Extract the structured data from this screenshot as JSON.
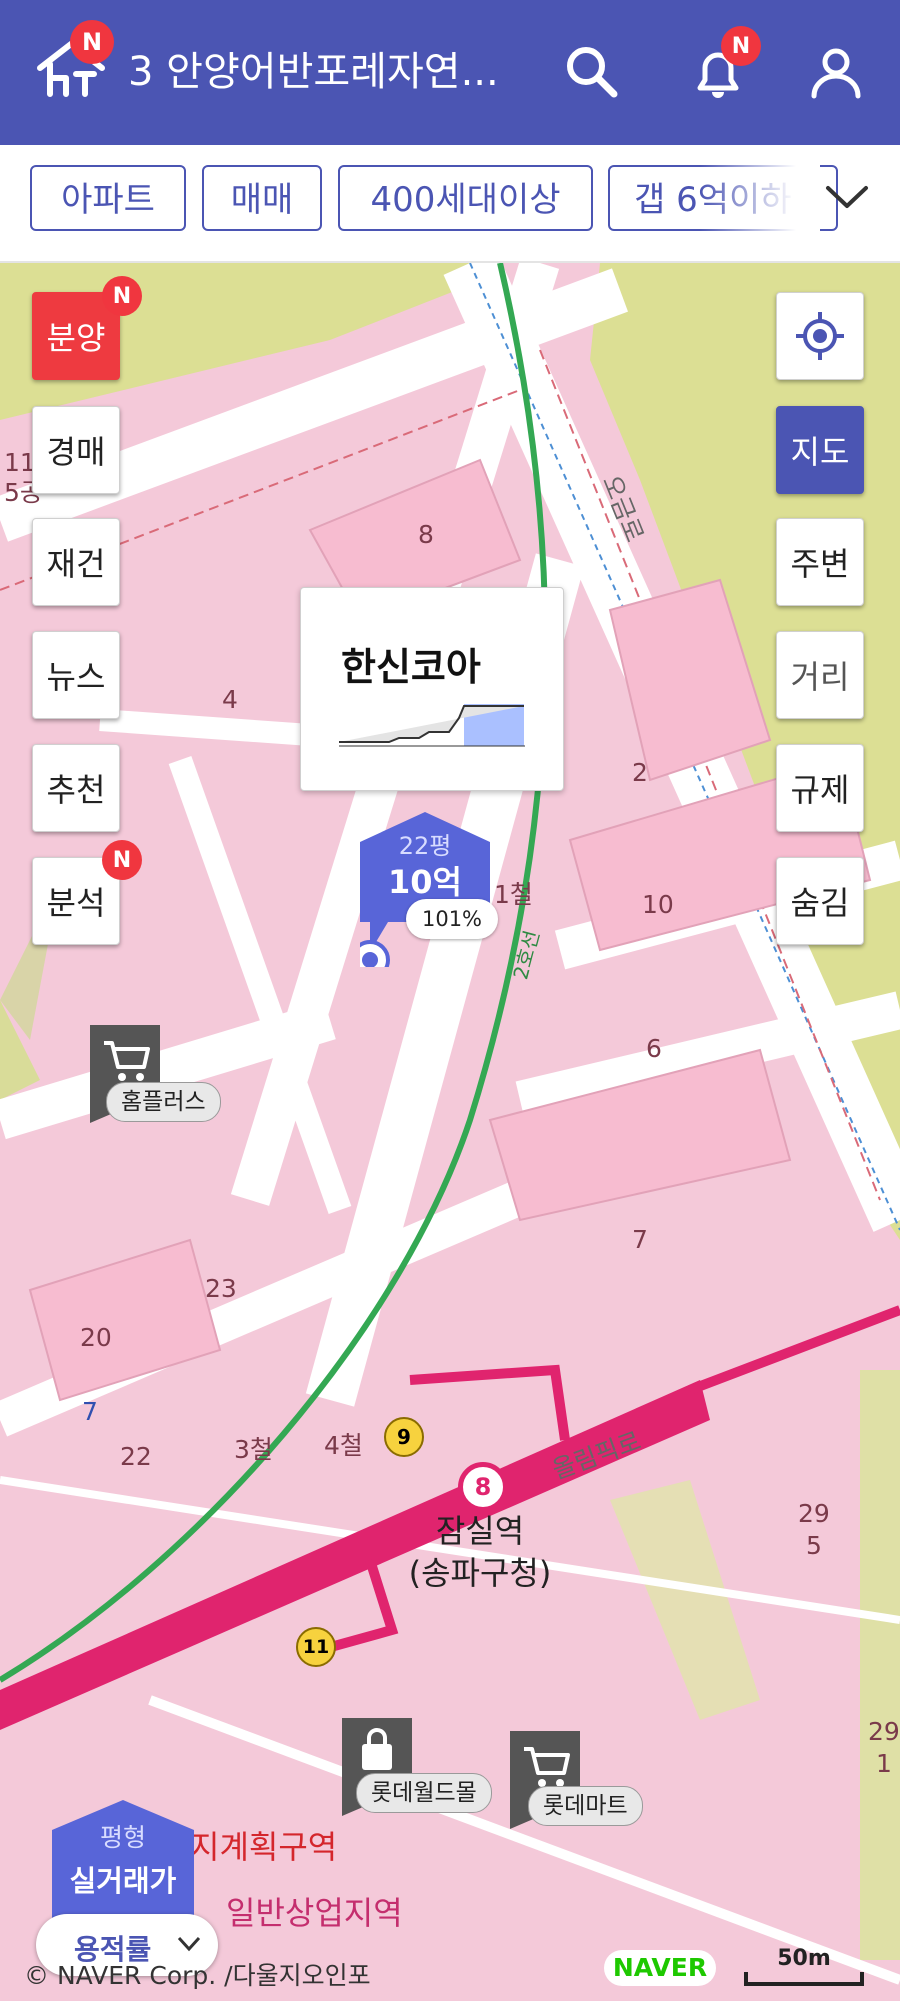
{
  "header": {
    "logo_badge": "N",
    "title": "3  안양어반포레자연...",
    "bell_badge": "N"
  },
  "filters": {
    "chips": [
      "아파트",
      "매매",
      "400세대이상",
      "갭 6억이하"
    ]
  },
  "left_buttons": [
    "분양",
    "경매",
    "재건",
    "뉴스",
    "추천",
    "분석"
  ],
  "left_badges": {
    "presale": "N",
    "analysis": "N"
  },
  "right_buttons": [
    "지도",
    "주변",
    "거리",
    "규제",
    "숨김"
  ],
  "popup": {
    "name": "한신코아"
  },
  "marker": {
    "size": "22평",
    "price": "10억",
    "percent": "101%"
  },
  "map_labels": {
    "blocks": [
      "8",
      "4",
      "2",
      "10",
      "6",
      "7",
      "23",
      "20",
      "22",
      "7",
      "29\n5",
      "29\n1",
      "11\n5공"
    ],
    "rail_exits": [
      "1철",
      "3철",
      "4철"
    ],
    "road_1": "오금로",
    "road_2": "올림픽로",
    "line2": "2호선",
    "line8": "8",
    "exit_9": "9",
    "exit_11": "11",
    "station_name": "잠실역",
    "station_sub": "(송파구청)",
    "zone_1": "지계획구역",
    "zone_2": "일반상업지역"
  },
  "pois": [
    {
      "label": "홈플러스",
      "icon": "cart-icon"
    },
    {
      "label": "롯데월드몰",
      "icon": "shopping-bag-icon"
    },
    {
      "label": "롯데마트",
      "icon": "cart-icon"
    }
  ],
  "legend": {
    "top": "평형",
    "main": "실거래가",
    "ratio_label": "용적률"
  },
  "footer": {
    "copyright": "© NAVER Corp. /다울지오인포",
    "naver": "NAVER",
    "scale": "50m"
  },
  "colors": {
    "brand": "#4b55b3",
    "red": "#ee3a40",
    "line2": "#34a853",
    "line8": "#e0246e"
  }
}
